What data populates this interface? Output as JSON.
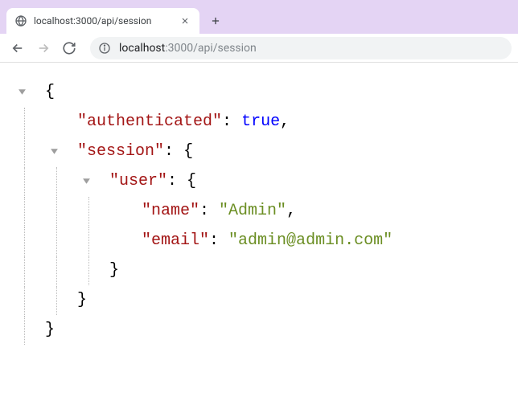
{
  "tab": {
    "title": "localhost:3000/api/session"
  },
  "url": {
    "host": "localhost",
    "path": ":3000/api/session"
  },
  "json": {
    "key_authenticated": "\"authenticated\"",
    "val_authenticated": "true",
    "key_session": "\"session\"",
    "key_user": "\"user\"",
    "key_name": "\"name\"",
    "val_name": "\"Admin\"",
    "key_email": "\"email\"",
    "val_email": "\"admin@admin.com\""
  },
  "punct": {
    "obrace": "{",
    "cbrace": "}",
    "colon": ":",
    "comma": ","
  }
}
